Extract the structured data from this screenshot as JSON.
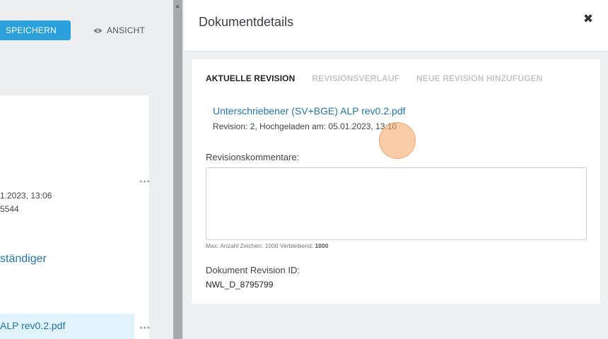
{
  "background": {
    "save_button": "SPEICHERN",
    "view_button": "ANSICHT",
    "meta_line_1": "1.2023, 13:06",
    "meta_line_2": "5544",
    "heading_partial": "ständiger",
    "file_partial": "ALP rev0.2.pdf",
    "more_menu_glyph": "•••"
  },
  "drawer": {
    "title": "Dokumentdetails",
    "close_glyph": "✖",
    "tabs": [
      {
        "label": "AKTUELLE REVISION",
        "active": true
      },
      {
        "label": "REVISIONSVERLAUF",
        "active": false
      },
      {
        "label": "NEUE REVISION HINZUFÜGEN",
        "active": false
      }
    ],
    "file_name": "Unterschriebener (SV+BGE) ALP rev0.2.pdf",
    "file_meta": "Revision: 2, Hochgeladen am: 05.01.2023, 13:10",
    "comments_label": "Revisionskommentare:",
    "comments_value": "",
    "char_hint_prefix": "Max. Anzahl Zeichen: 1000 Verbleibend:",
    "char_hint_remaining": "1000",
    "revision_id_label": "Dokument Revision ID:",
    "revision_id_value": "NWL_D_8795799"
  },
  "colors": {
    "accent": "#2aa0dc",
    "link": "#2275a8",
    "tab_inactive": "#c3c6c9",
    "click_marker": "#f7aa6e"
  },
  "icons": {
    "view": "eye-icon",
    "close": "close-icon",
    "more": "more-horizontal-icon"
  }
}
